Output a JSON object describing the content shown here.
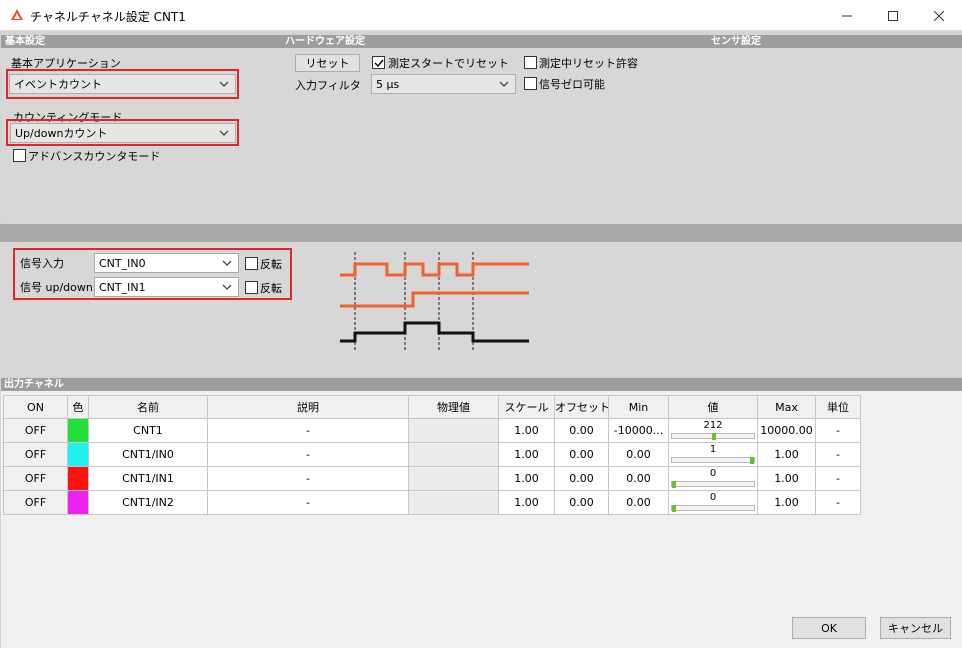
{
  "window": {
    "title": "チャネルチャネル設定 CNT1",
    "minimize": "—",
    "maximize": "☐",
    "close": "✕"
  },
  "sections": {
    "basic": "基本設定",
    "hardware": "ハードウェア設定",
    "sensor": "センサ設定",
    "output": "出力チャネル"
  },
  "basic": {
    "app_label": "基本アプリケーション",
    "app_value": "イベントカウント",
    "mode_label": "カウンティングモード",
    "mode_value": "Up/downカウント",
    "advanced_label": "アドバンスカウンタモード",
    "advanced_checked": false
  },
  "hardware": {
    "reset_button": "リセット",
    "reset_on_start_label": "測定スタートでリセット",
    "reset_on_start_checked": true,
    "filter_label": "入力フィルタ",
    "filter_value": "5 µs",
    "allow_reset_label": "測定中リセット許容",
    "allow_reset_checked": false,
    "zero_signal_label": "信号ゼロ可能",
    "zero_signal_checked": false
  },
  "signals": {
    "input_label": "信号入力",
    "input_value": "CNT_IN0",
    "input_invert_label": "反転",
    "updown_label": "信号 up/down",
    "updown_value": "CNT_IN1",
    "updown_invert_label": "反転"
  },
  "table": {
    "headers": [
      "ON",
      "色",
      "名前",
      "説明",
      "物理値",
      "スケール",
      "オフセット",
      "Min",
      "値",
      "Max",
      "単位"
    ],
    "rows": [
      {
        "on": "OFF",
        "color": "#22e03a",
        "name": "CNT1",
        "desc": "-",
        "phys": "",
        "scale": "1.00",
        "offset": "0.00",
        "min": "-10000...",
        "value": "212",
        "value_frac": 0.51,
        "max": "10000.00",
        "unit": "-"
      },
      {
        "on": "OFF",
        "color": "#22f0f0",
        "name": "CNT1/IN0",
        "desc": "-",
        "phys": "",
        "scale": "1.00",
        "offset": "0.00",
        "min": "0.00",
        "value": "1",
        "value_frac": 1.0,
        "max": "1.00",
        "unit": "-"
      },
      {
        "on": "OFF",
        "color": "#ff1111",
        "name": "CNT1/IN1",
        "desc": "-",
        "phys": "",
        "scale": "1.00",
        "offset": "0.00",
        "min": "0.00",
        "value": "0",
        "value_frac": 0.0,
        "max": "1.00",
        "unit": "-"
      },
      {
        "on": "OFF",
        "color": "#ee22ee",
        "name": "CNT1/IN2",
        "desc": "-",
        "phys": "",
        "scale": "1.00",
        "offset": "0.00",
        "min": "0.00",
        "value": "0",
        "value_frac": 0.0,
        "max": "1.00",
        "unit": "-"
      }
    ]
  },
  "footer": {
    "ok": "OK",
    "cancel": "キャンセル"
  },
  "colors": {
    "highlight": "#e0262b",
    "signal_orange": "#f06030",
    "bar_green": "#6abf2a"
  }
}
